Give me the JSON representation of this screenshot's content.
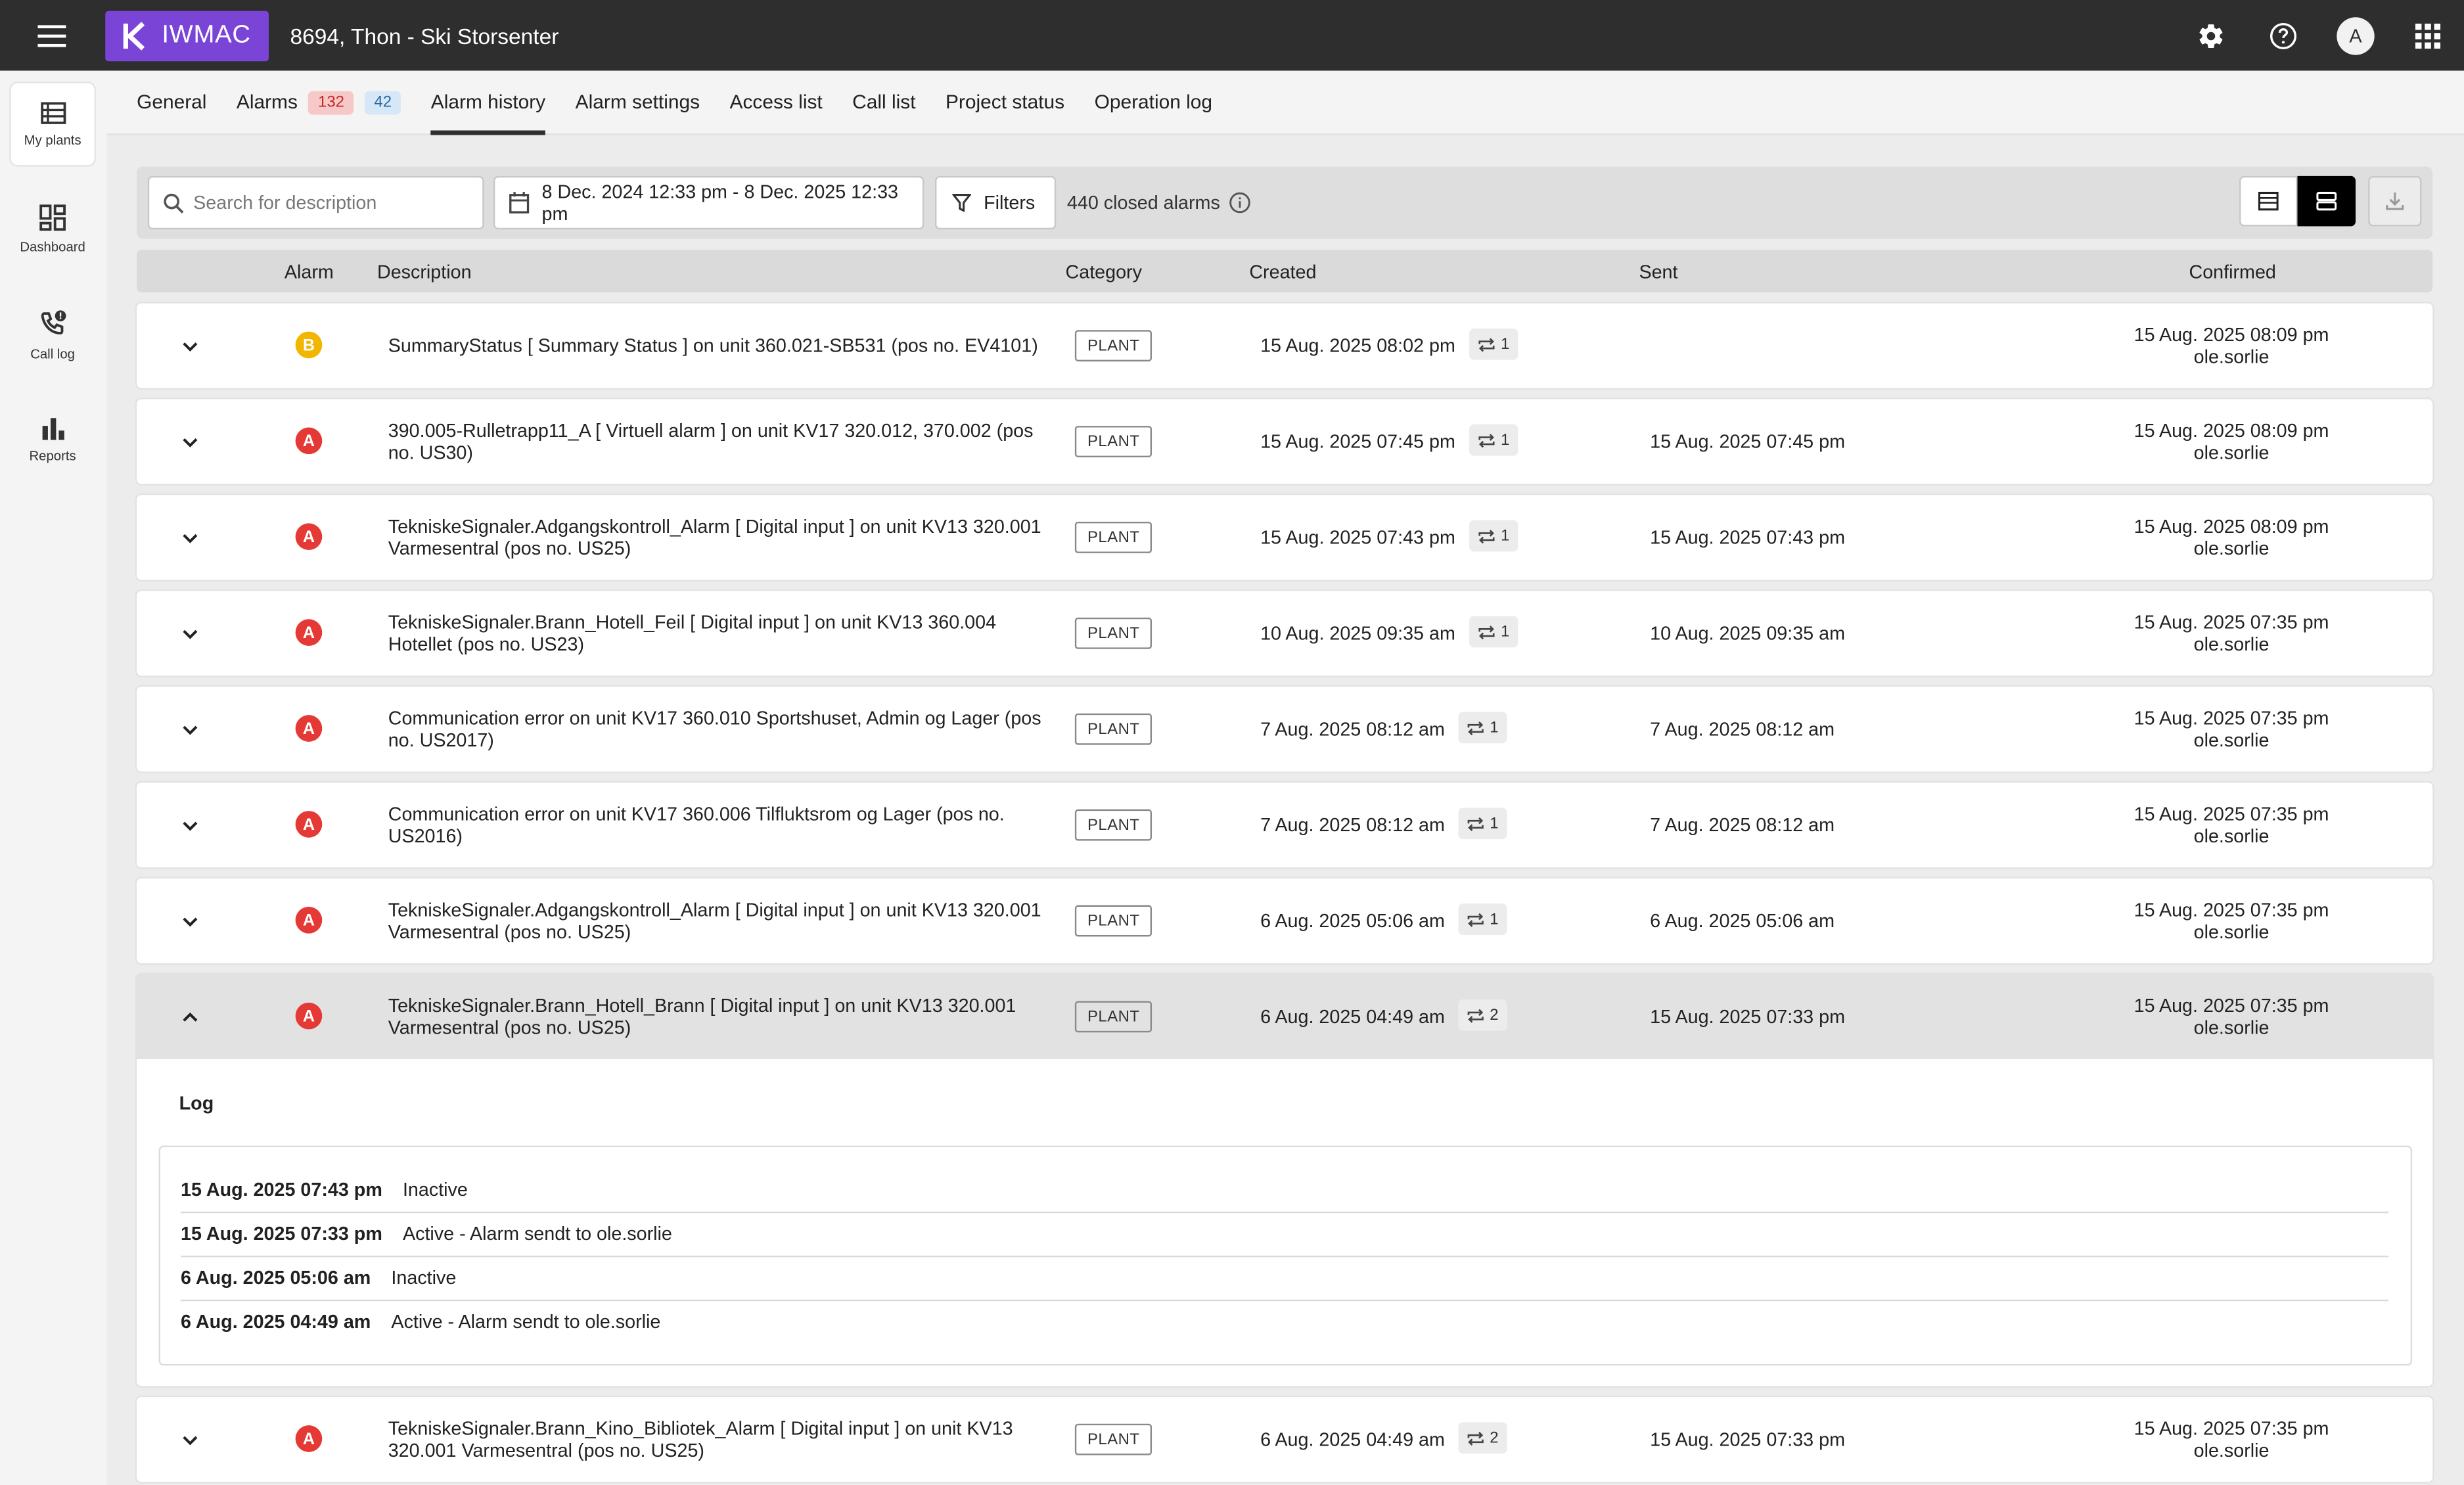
{
  "header": {
    "logo_text": "IWMAC",
    "plant_title": "8694, Thon - Ski Storsenter",
    "avatar_initial": "A"
  },
  "rail": {
    "items": [
      {
        "label": "My plants",
        "icon": "list-icon"
      },
      {
        "label": "Dashboard",
        "icon": "dashboard-icon"
      },
      {
        "label": "Call log",
        "icon": "phone-icon"
      },
      {
        "label": "Reports",
        "icon": "bar-chart-icon"
      }
    ]
  },
  "tabs": {
    "general": "General",
    "alarms": "Alarms",
    "alarms_red_count": "132",
    "alarms_blue_count": "42",
    "alarm_history": "Alarm history",
    "alarm_settings": "Alarm settings",
    "access_list": "Access list",
    "call_list": "Call list",
    "project_status": "Project status",
    "operation_log": "Operation log"
  },
  "toolbar": {
    "search_placeholder": "Search for description",
    "date_range": "8 Dec. 2024 12:33 pm - 8 Dec. 2025 12:33 pm",
    "filters_label": "Filters",
    "closed_count": "440 closed alarms"
  },
  "table": {
    "columns": {
      "alarm": "Alarm",
      "description": "Description",
      "category": "Category",
      "created": "Created",
      "sent": "Sent",
      "confirmed": "Confirmed"
    },
    "rows": [
      {
        "severity": "B",
        "description": "SummaryStatus [ Summary Status ] on unit 360.021-SB531 (pos no. EV4101)",
        "category": "PLANT",
        "created": "15 Aug. 2025 08:02 pm",
        "repeat": "1",
        "sent": "",
        "confirmed_time": "15 Aug. 2025 08:09 pm",
        "confirmed_by": "ole.sorlie"
      },
      {
        "severity": "A",
        "description": "390.005-Rulletrapp11_A [ Virtuell alarm ] on unit KV17 320.012, 370.002 (pos no. US30)",
        "category": "PLANT",
        "created": "15 Aug. 2025 07:45 pm",
        "repeat": "1",
        "sent": "15 Aug. 2025 07:45 pm",
        "confirmed_time": "15 Aug. 2025 08:09 pm",
        "confirmed_by": "ole.sorlie"
      },
      {
        "severity": "A",
        "description": "TekniskeSignaler.Adgangskontroll_Alarm [ Digital input ] on unit KV13 320.001 Varmesentral (pos no. US25)",
        "category": "PLANT",
        "created": "15 Aug. 2025 07:43 pm",
        "repeat": "1",
        "sent": "15 Aug. 2025 07:43 pm",
        "confirmed_time": "15 Aug. 2025 08:09 pm",
        "confirmed_by": "ole.sorlie"
      },
      {
        "severity": "A",
        "description": "TekniskeSignaler.Brann_Hotell_Feil [ Digital input ] on unit KV13 360.004 Hotellet (pos no. US23)",
        "category": "PLANT",
        "created": "10 Aug. 2025 09:35 am",
        "repeat": "1",
        "sent": "10 Aug. 2025 09:35 am",
        "confirmed_time": "15 Aug. 2025 07:35 pm",
        "confirmed_by": "ole.sorlie"
      },
      {
        "severity": "A",
        "description": "Communication error on unit KV17 360.010 Sportshuset, Admin og Lager (pos no. US2017)",
        "category": "PLANT",
        "created": "7 Aug. 2025 08:12 am",
        "repeat": "1",
        "sent": "7 Aug. 2025 08:12 am",
        "confirmed_time": "15 Aug. 2025 07:35 pm",
        "confirmed_by": "ole.sorlie"
      },
      {
        "severity": "A",
        "description": "Communication error on unit KV17 360.006 Tilfluktsrom og Lager (pos no. US2016)",
        "category": "PLANT",
        "created": "7 Aug. 2025 08:12 am",
        "repeat": "1",
        "sent": "7 Aug. 2025 08:12 am",
        "confirmed_time": "15 Aug. 2025 07:35 pm",
        "confirmed_by": "ole.sorlie"
      },
      {
        "severity": "A",
        "description": "TekniskeSignaler.Adgangskontroll_Alarm [ Digital input ] on unit KV13 320.001 Varmesentral (pos no. US25)",
        "category": "PLANT",
        "created": "6 Aug. 2025 05:06 am",
        "repeat": "1",
        "sent": "6 Aug. 2025 05:06 am",
        "confirmed_time": "15 Aug. 2025 07:35 pm",
        "confirmed_by": "ole.sorlie"
      },
      {
        "severity": "A",
        "description": "TekniskeSignaler.Brann_Hotell_Brann [ Digital input ] on unit KV13 320.001 Varmesentral (pos no. US25)",
        "category": "PLANT",
        "created": "6 Aug. 2025 04:49 am",
        "repeat": "2",
        "sent": "15 Aug. 2025 07:33 pm",
        "confirmed_time": "15 Aug. 2025 07:35 pm",
        "confirmed_by": "ole.sorlie"
      },
      {
        "severity": "A",
        "description": "TekniskeSignaler.Brann_Kino_Bibliotek_Alarm [ Digital input ] on unit KV13 320.001 Varmesentral (pos no. US25)",
        "category": "PLANT",
        "created": "6 Aug. 2025 04:49 am",
        "repeat": "2",
        "sent": "15 Aug. 2025 07:33 pm",
        "confirmed_time": "15 Aug. 2025 07:35 pm",
        "confirmed_by": "ole.sorlie"
      }
    ]
  },
  "log": {
    "title": "Log",
    "entries": [
      {
        "time": "15 Aug. 2025 07:43 pm",
        "text": "Inactive"
      },
      {
        "time": "15 Aug. 2025 07:33 pm",
        "text": "Active - Alarm sendt to ole.sorlie"
      },
      {
        "time": "6 Aug. 2025 05:06 am",
        "text": "Inactive"
      },
      {
        "time": "6 Aug. 2025 04:49 am",
        "text": "Active - Alarm sendt to ole.sorlie"
      }
    ]
  },
  "colors": {
    "brand": "#7a45d6",
    "topbar": "#2e2e2e",
    "severity_a": "#e53935",
    "severity_b": "#f2b600"
  }
}
